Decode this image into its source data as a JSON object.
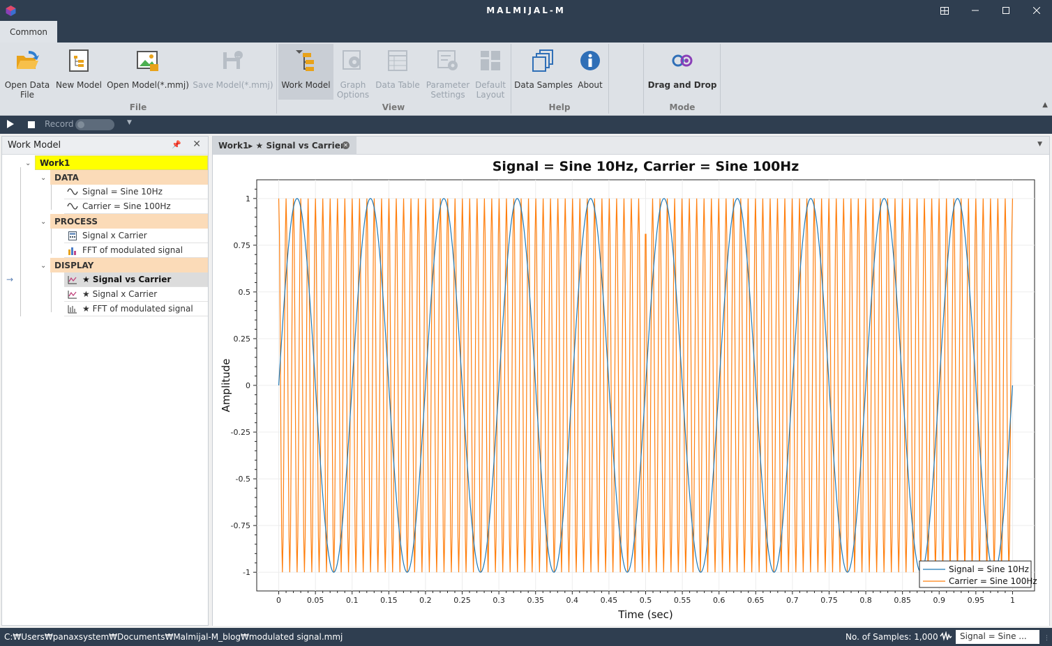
{
  "app": {
    "title": "MALMIJAL-M"
  },
  "window_buttons": [
    "restore-icon",
    "minimize-icon",
    "maximize-icon",
    "close-icon"
  ],
  "ribbon": {
    "tab": "Common",
    "buttons": {
      "open_data_file": "Open Data\nFile",
      "new_model": "New Model",
      "open_model": "Open Model(*.mmj)",
      "save_model": "Save Model(*.mmj)",
      "work_model": "Work Model",
      "graph_options": "Graph\nOptions",
      "data_table": "Data Table",
      "parameter_settings": "Parameter\nSettings",
      "default_layout": "Default\nLayout",
      "data_samples": "Data Samples",
      "about": "About",
      "drag_and_drop": "Drag and Drop"
    },
    "groups": {
      "file": "File",
      "view": "View",
      "help": "Help",
      "mode": "Mode"
    }
  },
  "toolbar": {
    "record_label": "Record"
  },
  "work_model_panel": {
    "title": "Work Model",
    "root": "Work1",
    "categories": {
      "data": "DATA",
      "process": "PROCESS",
      "display": "DISPLAY"
    },
    "data_items": [
      "Signal = Sine 10Hz",
      "Carrier = Sine 100Hz"
    ],
    "process_items": [
      "Signal x Carrier",
      "FFT of modulated signal"
    ],
    "display_items": [
      "★ Signal vs Carrier",
      "★ Signal x Carrier",
      "★ FFT of modulated signal"
    ]
  },
  "document": {
    "tab_label": "Work1▸ ★ Signal vs Carrier"
  },
  "chart_data": {
    "type": "line",
    "title": "Signal = Sine 10Hz, Carrier = Sine 100Hz",
    "xlabel": "Time (sec)",
    "ylabel": "Amplitude",
    "xlim": [
      -0.03,
      1.03
    ],
    "ylim": [
      -1.1,
      1.1
    ],
    "x_ticks": [
      "0",
      "0.05",
      "0.1",
      "0.15",
      "0.2",
      "0.25",
      "0.3",
      "0.35",
      "0.4",
      "0.45",
      "0.5",
      "0.55",
      "0.6",
      "0.65",
      "0.7",
      "0.75",
      "0.8",
      "0.85",
      "0.9",
      "0.95",
      "1"
    ],
    "y_ticks": [
      "1",
      "0.75",
      "0.5",
      "0.25",
      "0",
      "-0.25",
      "-0.5",
      "-0.75",
      "-1"
    ],
    "grid": true,
    "legend_position": "bottom-right",
    "series": [
      {
        "name": "Signal = Sine 10Hz",
        "color": "#1f77b4",
        "frequency_hz": 10,
        "amplitude": 1,
        "x_start": 0,
        "x_end": 1,
        "samples": 1000
      },
      {
        "name": "Carrier = Sine 100Hz",
        "color": "#ff7f0e",
        "frequency_hz": 100,
        "amplitude": 1,
        "x_start": 0,
        "x_end": 1,
        "samples": 1000
      }
    ]
  },
  "status": {
    "path": "C:₩Users₩panaxsystem₩Documents₩Malmijal-M_blog₩modulated signal.mmj",
    "samples": "No. of Samples: 1,000",
    "selected_series": "Signal = Sine ..."
  }
}
